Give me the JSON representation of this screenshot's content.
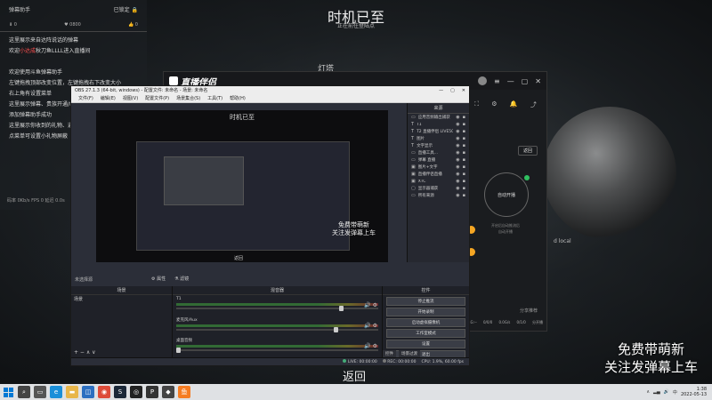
{
  "stream": {
    "title": "时机已至",
    "subtitle": "正在前往登陆点",
    "lantern": "灯塔",
    "promo_line1": "免费带萌新",
    "promo_line2": "关注发弹幕上车",
    "back": "返回",
    "local_text": "d local"
  },
  "chat": {
    "title": "弹幕助手",
    "status": "已锁定",
    "lock_icon": "lock-icon",
    "stats": [
      "0",
      "0800",
      "0"
    ],
    "messages": [
      {
        "pre": "这里展示来自达阵说话的弹幕",
        "hl": "",
        "post": ""
      },
      {
        "pre": "欢迎",
        "hl": "小达成",
        "post": "秋刀鱼LLLL进入直播间"
      },
      {
        "pre": "",
        "hl": "",
        "post": ""
      },
      {
        "pre": "欢迎使用斗鱼弹幕助手",
        "hl": "",
        "post": ""
      },
      {
        "pre": "左键拖拽顶部改变位置，左键拖拽右下改变大小",
        "hl": "",
        "post": ""
      },
      {
        "pre": "右上角有设置菜单",
        "hl": "",
        "post": ""
      },
      {
        "pre": "这里展示弹幕、贵族开通/续费、粉丝团升级等",
        "hl": "",
        "post": ""
      },
      {
        "pre": "添加弹幕助手成功",
        "hl": "",
        "post": ""
      },
      {
        "pre": "这里展示你收到的礼物、道具",
        "hl": "",
        "post": ""
      },
      {
        "pre": "点菜单可设置小礼物屏蔽",
        "hl": "",
        "post": ""
      }
    ],
    "footer": "码率 0Kb/s FPS 0 延迟 0.0s"
  },
  "zb": {
    "logo": "直播伴侣",
    "back_button": "返回",
    "start_label": "自动开播",
    "hint1": "开启后自动推流后",
    "hint2": "自动开播",
    "bottom": [
      "4G:--",
      "0/0/0",
      "0.0G/s",
      "0/1/0",
      "分开播"
    ],
    "share": "分享推荐"
  },
  "obs": {
    "title": "OBS 27.1.3 (64-bit, windows) - 配置文件: 未命名 - 场景: 未命名",
    "menu": [
      "文件(F)",
      "编辑(E)",
      "视图(V)",
      "配置文件(P)",
      "场景集合(S)",
      "工具(T)",
      "帮助(H)"
    ],
    "preview_title": "时机已至",
    "preview_promo1": "免费带萌新",
    "preview_promo2": "关注发弹幕上车",
    "preview_back": "返回",
    "sources_header": "来源",
    "sources": [
      {
        "icon": "window",
        "label": "应用音频输出捕获"
      },
      {
        "icon": "text",
        "label": "T1"
      },
      {
        "icon": "text",
        "label": "T2 直播伴侣 LIVE5000"
      },
      {
        "icon": "text",
        "label": "图片"
      },
      {
        "icon": "text",
        "label": "文字显示"
      },
      {
        "icon": "window",
        "label": "直播工具..."
      },
      {
        "icon": "window",
        "label": "弹幕 直播"
      },
      {
        "icon": "image",
        "label": "图片+文字"
      },
      {
        "icon": "image",
        "label": "直播伴侣直播"
      },
      {
        "icon": "image",
        "label": "XTC"
      },
      {
        "icon": "monitor",
        "label": "显示器捕获"
      },
      {
        "icon": "window",
        "label": "所有来源"
      }
    ],
    "unselected": "未选择源",
    "props_label": "属性",
    "filters_label": "滤镜",
    "scenes_header": "场景",
    "scene_item": "场景",
    "mixer_header": "混音器",
    "mixer_tracks": [
      {
        "name": "T1",
        "level": 0.85
      },
      {
        "name": "麦克风/Aux",
        "level": 0.82
      },
      {
        "name": "桌面音频",
        "level": 0.0
      }
    ],
    "controls_header": "控件",
    "controls": [
      "停止推流",
      "开始录制",
      "启动虚拟摄像机",
      "工作室模式",
      "设置",
      "退出"
    ],
    "tabs": [
      "控件",
      "场景过渡"
    ],
    "status": {
      "live": "LIVE: 00:00:00",
      "rec": "REC: 00:00:00",
      "cpu": "CPU: 1.9%, 60.00 fps"
    }
  },
  "taskbar": {
    "time": "1:38",
    "date": "2022-05-13",
    "icons": [
      {
        "name": "search-icon",
        "color": "#444444",
        "glyph": "⌕"
      },
      {
        "name": "task-view-icon",
        "color": "#555555",
        "glyph": "▭"
      },
      {
        "name": "edge-icon",
        "color": "#1a8fd9",
        "glyph": "e"
      },
      {
        "name": "folder-icon",
        "color": "#e8b64a",
        "glyph": "▬"
      },
      {
        "name": "store-icon",
        "color": "#2c6fc0",
        "glyph": "◫"
      },
      {
        "name": "chrome-icon",
        "color": "#dd4b39",
        "glyph": "◉"
      },
      {
        "name": "steam-icon",
        "color": "#1b2838",
        "glyph": "S"
      },
      {
        "name": "obs-icon",
        "color": "#222222",
        "glyph": "◎"
      },
      {
        "name": "game-icon",
        "color": "#333333",
        "glyph": "P"
      },
      {
        "name": "app-icon",
        "color": "#444444",
        "glyph": "◆"
      },
      {
        "name": "douyu-icon",
        "color": "#f57c22",
        "glyph": "鱼"
      }
    ]
  },
  "colors": {
    "accent_orange": "#f5a623",
    "live_green": "#30c060",
    "highlight_red": "#ff5050",
    "selected_blue": "#3d5aa8"
  }
}
